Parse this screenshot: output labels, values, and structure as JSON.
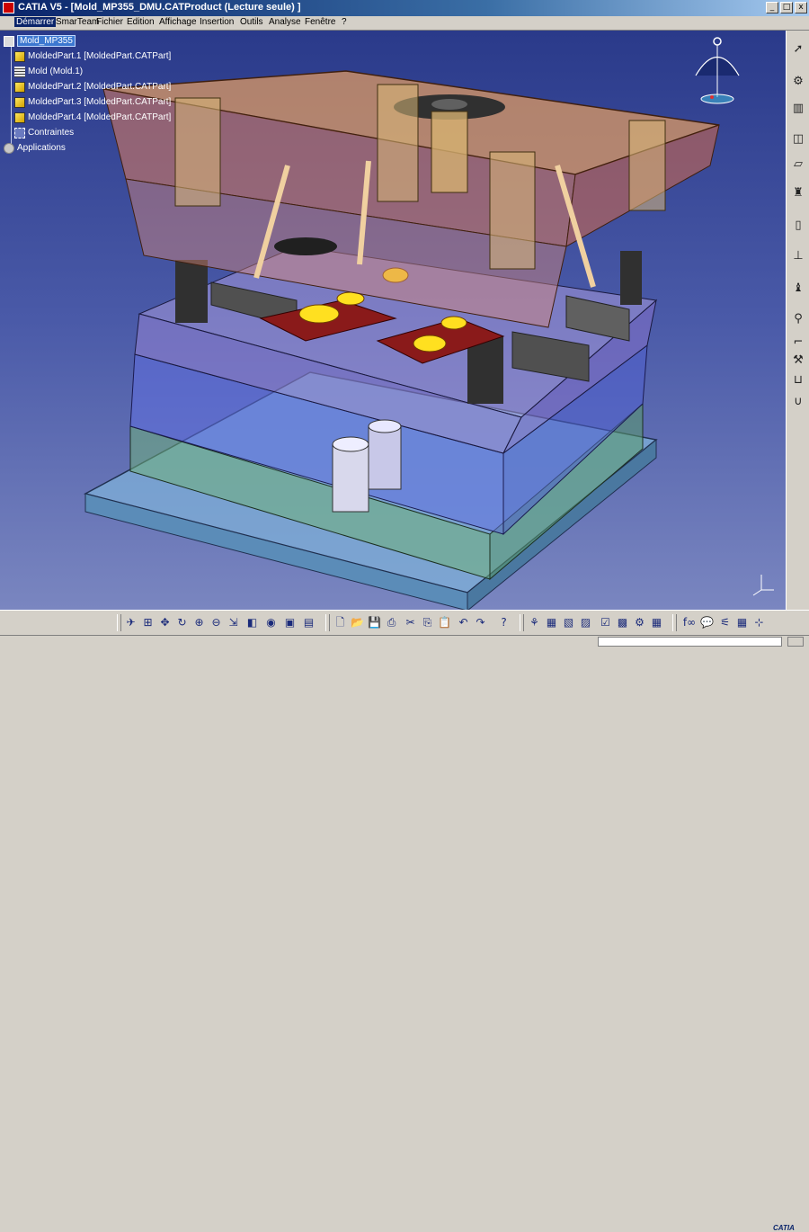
{
  "window": {
    "title": "CATIA V5 - [Mold_MP355_DMU.CATProduct (Lecture seule) ]",
    "buttons": [
      "_",
      "□",
      "x"
    ]
  },
  "menu": [
    {
      "label": "Démarrer",
      "active": true
    },
    {
      "label": "SmarTeam"
    },
    {
      "label": "Fichier"
    },
    {
      "label": "Edition"
    },
    {
      "label": "Affichage"
    },
    {
      "label": "Insertion"
    },
    {
      "label": "Outils"
    },
    {
      "label": "Analyse"
    },
    {
      "label": "Fenêtre"
    },
    {
      "label": "?"
    }
  ],
  "tree": [
    {
      "label": "Mold_MP355",
      "icon": "product-root-icon",
      "selected": true
    },
    {
      "label": "MoldedPart.1 [MoldedPart.CATPart]",
      "icon": "part-icon"
    },
    {
      "label": "Mold (Mold.1)",
      "icon": "mold-icon"
    },
    {
      "label": "MoldedPart.2 [MoldedPart.CATPart]",
      "icon": "part-icon"
    },
    {
      "label": "MoldedPart.3 [MoldedPart.CATPart]",
      "icon": "part-icon"
    },
    {
      "label": "MoldedPart.4 [MoldedPart.CATPart]",
      "icon": "part-icon"
    },
    {
      "label": "Contraintes",
      "icon": "constraints-icon"
    },
    {
      "label": "Applications",
      "icon": "applications-icon"
    }
  ],
  "logo_text": "CATIA",
  "colors": {
    "viewport_top": "#2a3a8a",
    "viewport_bottom": "#7a86c0",
    "title_bar": "#0a246a",
    "selection": "#3c78d0"
  },
  "right_toolbar_icons": [
    "select-arrow-icon",
    "tools-icon",
    "cylinder-icon",
    "eraser-icon",
    "probe-icon",
    "rectangle-icon",
    "bolt-icon",
    "pin-icon",
    "screw-icon",
    "bracket-icon",
    "lever-icon",
    "u-shape-icon"
  ],
  "bottom_toolbar_icons": [
    "fly-icon",
    "fit-all-icon",
    "pan-icon",
    "rotate-icon",
    "zoom-in-icon",
    "zoom-out-icon",
    "normal-view-icon",
    "views-icon",
    "render-style-icon",
    "hide-show-icon",
    "swap-space-icon",
    "new-icon",
    "open-icon",
    "save-icon",
    "print-icon",
    "cut-icon",
    "copy-icon",
    "paste-icon",
    "undo-icon",
    "redo-icon",
    "whats-this-icon",
    "catalog-icon",
    "formula-icon",
    "measure-icon",
    "knowledge-icon",
    "check-icon",
    "table-icon",
    "param-icon",
    "fx-icon",
    "comment-icon",
    "grid-icon",
    "axis-icon"
  ]
}
